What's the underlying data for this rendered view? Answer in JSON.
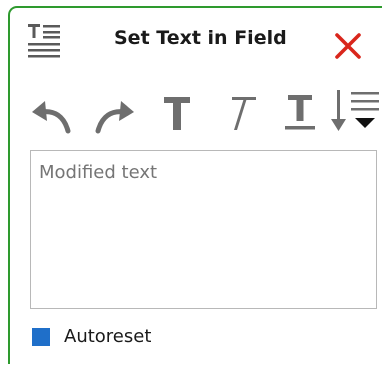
{
  "window": {
    "title": "Set Text in Field",
    "header_icon": "text-align-icon",
    "border_color": "#2e9a2e"
  },
  "toolbar": {
    "items": [
      {
        "icon": "undo-icon"
      },
      {
        "icon": "redo-icon"
      },
      {
        "icon": "bold-icon"
      },
      {
        "icon": "italic-icon"
      },
      {
        "icon": "underline-icon"
      },
      {
        "icon": "line-spacing-dropdown-icon"
      }
    ]
  },
  "text_field": {
    "placeholder": "Modified text",
    "value": ""
  },
  "autoreset": {
    "label": "Autoreset",
    "checked": true,
    "color": "#1f6fc9"
  },
  "close": {
    "icon": "close-icon",
    "color": "#d9261c"
  }
}
